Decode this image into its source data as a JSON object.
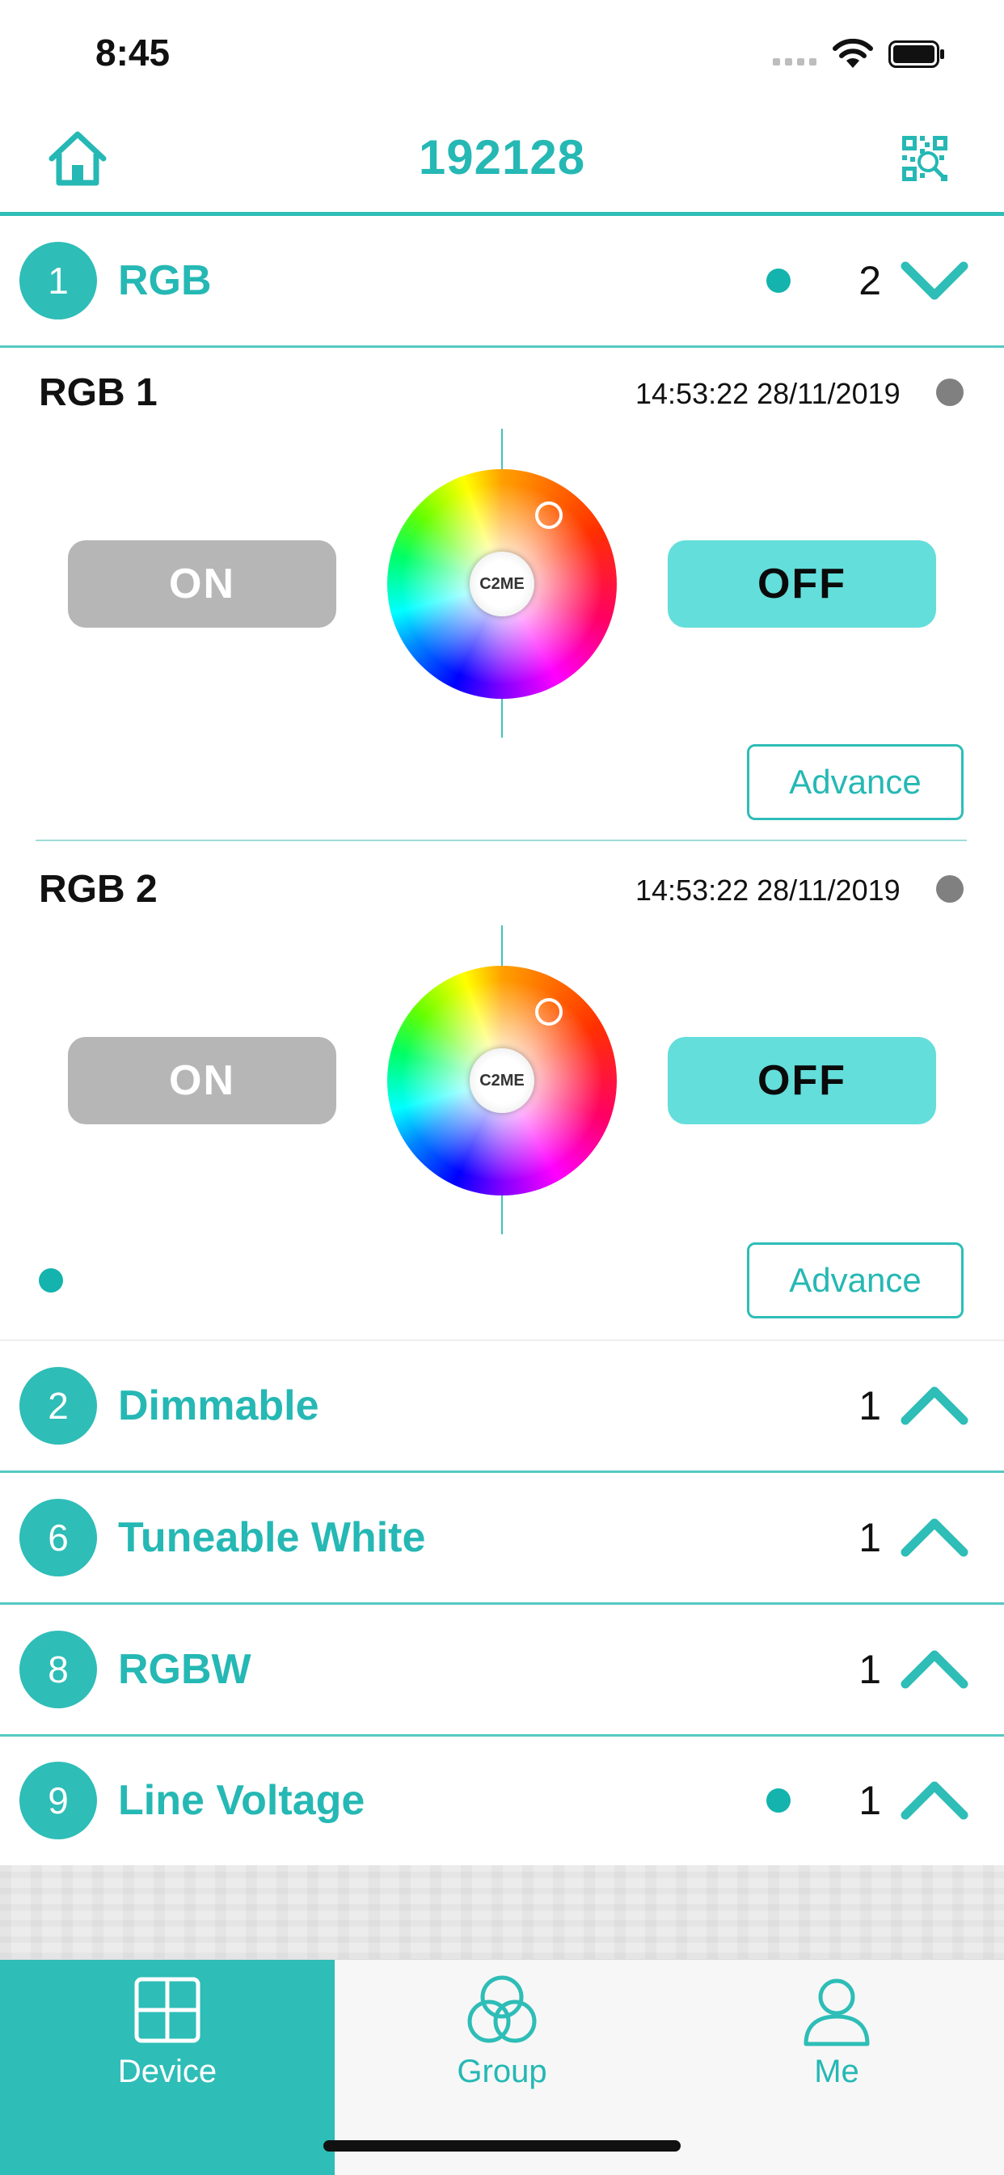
{
  "status_bar": {
    "time": "8:45"
  },
  "nav": {
    "title": "192128",
    "home_icon": "home-icon",
    "qr_icon": "qr-scan-icon"
  },
  "expanded_group": {
    "number": "1",
    "title": "RGB",
    "count": "2",
    "devices": [
      {
        "name": "RGB 1",
        "timestamp": "14:53:22 28/11/2019",
        "on_label": "ON",
        "off_label": "OFF",
        "wheel_center_text": "C2ME",
        "advance_label": "Advance"
      },
      {
        "name": "RGB 2",
        "timestamp": "14:53:22 28/11/2019",
        "on_label": "ON",
        "off_label": "OFF",
        "wheel_center_text": "C2ME",
        "advance_label": "Advance"
      }
    ]
  },
  "groups": [
    {
      "number": "2",
      "title": "Dimmable",
      "count": "1"
    },
    {
      "number": "6",
      "title": "Tuneable White",
      "count": "1"
    },
    {
      "number": "8",
      "title": "RGBW",
      "count": "1"
    },
    {
      "number": "9",
      "title": "Line Voltage",
      "count": "1"
    }
  ],
  "tabs": [
    {
      "label": "Device",
      "icon": "grid-icon",
      "active": true
    },
    {
      "label": "Group",
      "icon": "circles-icon",
      "active": false
    },
    {
      "label": "Me",
      "icon": "person-icon",
      "active": false
    }
  ],
  "colors": {
    "accent": "#2ebdb7",
    "off_button": "#63dedb",
    "on_button": "#b6b6b6"
  }
}
